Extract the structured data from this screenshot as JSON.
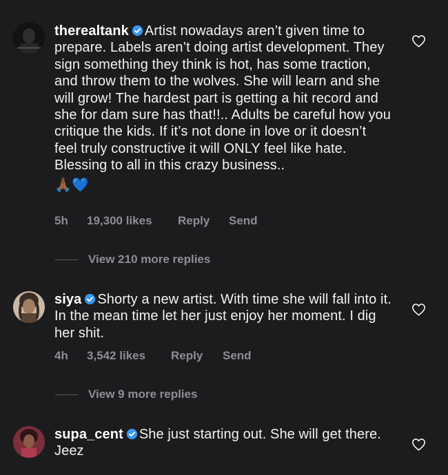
{
  "comments": [
    {
      "username": "therealtank",
      "text": "Artist nowadays aren’t given time to prepare. Labels aren’t doing artist development. They sign something they think is hot, has some traction, and throw them to the wolves. She will learn and she will grow! The hardest part is getting a hit record and she for dam sure has that!!.. Adults be careful how you critique the kids. If it’s not done in love or it doesn’t feel truly constructive it will ONLY feel like hate. Blessing to all in this crazy business..",
      "emoji": "🙏🏾💙",
      "time": "5h",
      "likes": "19,300 likes",
      "reply": "Reply",
      "send": "Send",
      "view_more": "View 210 more replies"
    },
    {
      "username": "siya",
      "text": "Shorty a new artist. With time she will fall into it. In the mean time let her just enjoy her moment. I dig her shit.",
      "time": "4h",
      "likes": "3,542 likes",
      "reply": "Reply",
      "send": "Send",
      "view_more": "View 9 more replies"
    },
    {
      "username": "supa_cent",
      "text": "She just starting out. She will get there. Jeez"
    }
  ],
  "colors": {
    "background": "#1c1c1e",
    "text": "#f2f2f2",
    "meta": "#8e8e93",
    "verified": "#3897f0"
  },
  "icons": [
    "verified-badge-icon",
    "heart-icon"
  ]
}
